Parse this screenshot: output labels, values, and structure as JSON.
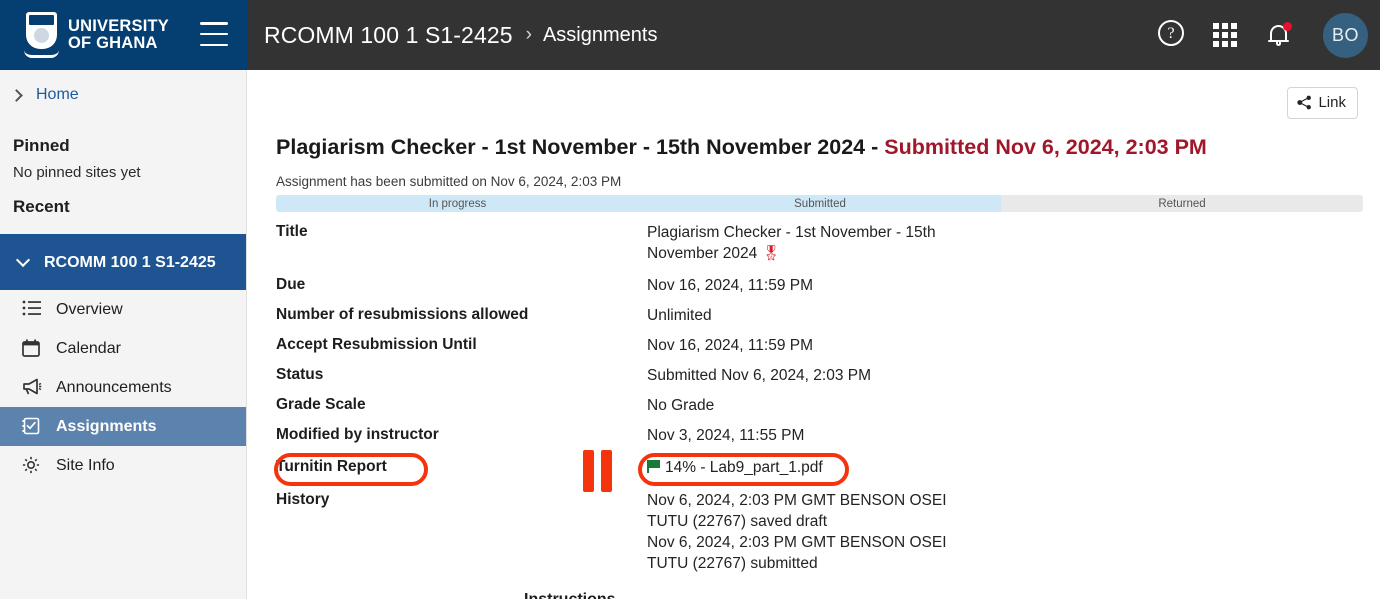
{
  "topbar": {
    "logo_line1": "UNIVERSITY",
    "logo_line2": "OF GHANA",
    "menu_icon": "hamburger-icon",
    "breadcrumb_course": "RCOMM 100 1 S1-2425",
    "breadcrumb_separator": "›",
    "breadcrumb_page": "Assignments",
    "help_label": "?",
    "avatar_initials": "BO"
  },
  "sidebar": {
    "home_label": "Home",
    "pinned_heading": "Pinned",
    "pinned_empty": "No pinned sites yet",
    "recent_heading": "Recent",
    "site_name": "RCOMM 100 1 S1-2425",
    "nav": [
      {
        "label": "Overview",
        "icon": "list-icon",
        "active": false
      },
      {
        "label": "Calendar",
        "icon": "calendar-icon",
        "active": false
      },
      {
        "label": "Announcements",
        "icon": "megaphone-icon",
        "active": false
      },
      {
        "label": "Assignments",
        "icon": "checked-note-icon",
        "active": true
      },
      {
        "label": "Site Info",
        "icon": "gear-icon",
        "active": false
      }
    ]
  },
  "main": {
    "link_button": "Link",
    "title_main": "Plagiarism Checker - 1st November - 15th November 2024 - ",
    "title_status": "Submitted Nov 6, 2024, 2:03 PM",
    "submitted_note": "Assignment has been submitted on Nov 6, 2024, 2:03 PM",
    "progress": {
      "segments": [
        {
          "label": "In progress",
          "state": "done",
          "width_pct": 33.4
        },
        {
          "label": "Submitted",
          "state": "done",
          "width_pct": 33.3
        },
        {
          "label": "Returned",
          "state": "todo",
          "width_pct": 33.3
        }
      ]
    },
    "details": [
      {
        "label": "Title",
        "value": "Plagiarism Checker - 1st November - 15th November 2024 ",
        "badge": "🎖"
      },
      {
        "label": "Due",
        "value": "Nov 16, 2024, 11:59 PM"
      },
      {
        "label": "Number of resubmissions allowed",
        "value": "Unlimited"
      },
      {
        "label": "Accept Resubmission Until",
        "value": "Nov 16, 2024, 11:59 PM"
      },
      {
        "label": "Status",
        "value": "Submitted Nov 6, 2024, 2:03 PM"
      },
      {
        "label": "Grade Scale",
        "value": "No Grade"
      },
      {
        "label": "Modified by instructor",
        "value": "Nov 3, 2024, 11:55 PM"
      }
    ],
    "turnitin": {
      "label": "Turnitin Report",
      "score_and_file": "14% - Lab9_part_1.pdf",
      "flag_icon": "green-flag-icon"
    },
    "history": {
      "label": "History",
      "entries": [
        "Nov 6, 2024, 2:03 PM GMT BENSON OSEI TUTU (22767) saved draft",
        "Nov 6, 2024, 2:03 PM GMT BENSON OSEI TUTU (22767) submitted"
      ]
    },
    "clipped_bottom_label": "Instructions"
  },
  "colors": {
    "brand_blue": "#053f72",
    "titlebar_gray": "#333333",
    "active_nav": "#5b83ae",
    "site_row": "#1f5492",
    "status_red": "#a0172b",
    "annotation_red": "#f5330c",
    "progress_done": "#cfe8f7",
    "progress_todo": "#e9e9e9",
    "flag_green": "#157a3a"
  }
}
